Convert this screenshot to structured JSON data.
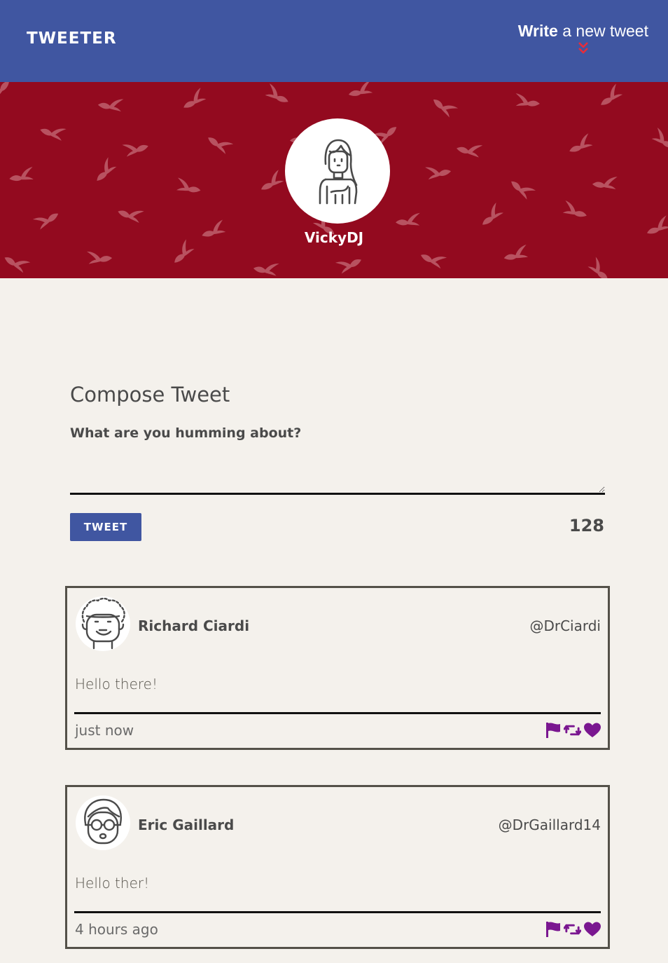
{
  "nav": {
    "brand": "TWEETER",
    "write_bold": "Write",
    "write_rest": " a new tweet",
    "accent_color": "#e82c3a",
    "chevron_icon": "double-chevron-down-icon"
  },
  "profile": {
    "username": "VickyDJ",
    "avatar_icon": "woman-avatar-icon",
    "banner_color": "#930a1f"
  },
  "compose": {
    "title": "Compose Tweet",
    "placeholder": "What are you humming about?",
    "button_label": "TWEET",
    "counter": "128"
  },
  "tweets": [
    {
      "name": "Richard Ciardi",
      "handle": "@DrCiardi",
      "content": "Hello there!",
      "time": "just now",
      "avatar_icon": "curly-hair-man-avatar-icon"
    },
    {
      "name": "Eric Gaillard",
      "handle": "@DrGaillard14",
      "content": "Hello ther!",
      "time": "4 hours ago",
      "avatar_icon": "glasses-man-avatar-icon"
    }
  ],
  "colors": {
    "primary": "#4056a1",
    "action_icons": "#7a1790",
    "background": "#f4f1ec"
  }
}
